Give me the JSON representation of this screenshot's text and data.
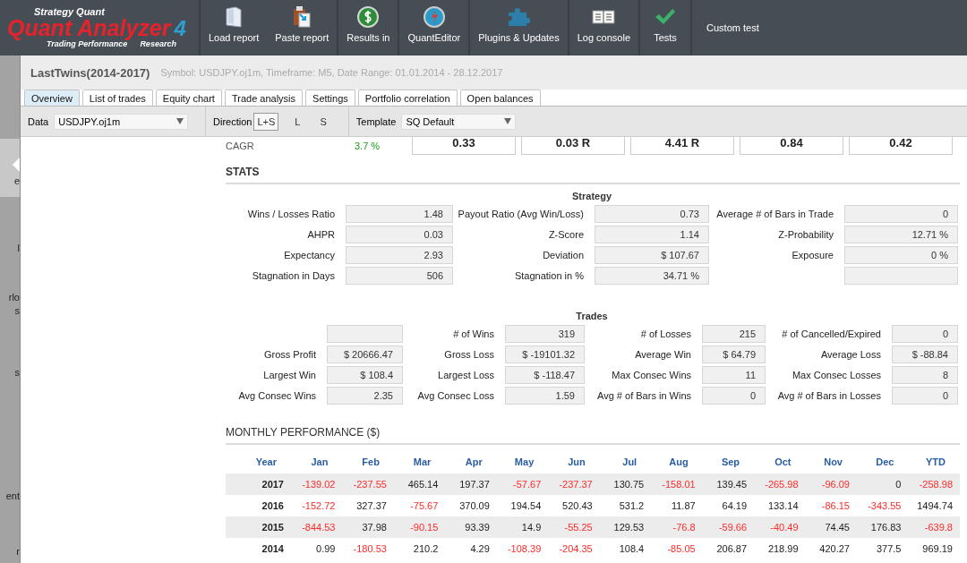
{
  "logo": {
    "brand": "Strategy Quant",
    "product": "Quant Analyzer",
    "version": "4",
    "tagline_left": "Trading Performance",
    "tagline_right": "Research"
  },
  "toolbar": {
    "groups": [
      [
        "Load report",
        "Paste report"
      ],
      [
        "Results in"
      ],
      [
        "QuantEditor"
      ],
      [
        "Plugins & Updates"
      ],
      [
        "Log console"
      ],
      [
        "Tests"
      ],
      [
        "Custom test"
      ]
    ]
  },
  "sidebar": {
    "items": [
      {
        "text": "e",
        "selected": true
      },
      {
        "text": "l",
        "selected": false
      },
      {
        "text": "rlo",
        "selected": false
      },
      {
        "text": "s",
        "selected": false
      },
      {
        "text": "s",
        "selected": false
      },
      {
        "text": "ent",
        "selected": false
      },
      {
        "text": "r",
        "selected": false
      }
    ]
  },
  "report": {
    "title": "LastTwins(2014-2017)",
    "subtitle": "Symbol: USDJPY.oj1m, Timeframe: M5, Date Range: 01.01.2014 - 28.12.2017"
  },
  "tabs": [
    {
      "label": "Overview",
      "selected": true
    },
    {
      "label": "List of trades",
      "selected": false
    },
    {
      "label": "Equity chart",
      "selected": false
    },
    {
      "label": "Trade analysis",
      "selected": false
    },
    {
      "label": "Settings",
      "selected": false
    },
    {
      "label": "Portfolio correlation",
      "selected": false
    },
    {
      "label": "Open balances",
      "selected": false
    }
  ],
  "options": {
    "data_label": "Data",
    "data_value": "USDJPY.oj1m",
    "direction_label": "Direction",
    "directions": [
      {
        "label": "L+S",
        "selected": true
      },
      {
        "label": "L",
        "selected": false
      },
      {
        "label": "S",
        "selected": false
      }
    ],
    "template_label": "Template",
    "template_value": "SQ Default"
  },
  "cagr": {
    "label": "CAGR",
    "value": "3.7 %"
  },
  "headline_values": [
    "0.33",
    "0.03 R",
    "4.41 R",
    "0.84",
    "0.42"
  ],
  "stats_heading": "STATS",
  "strategy": {
    "title": "Strategy",
    "items": [
      {
        "kind": "stat",
        "label": "Wins / Losses Ratio",
        "value": "1.48"
      },
      {
        "kind": "stat",
        "label": "Payout Ratio (Avg Win/Loss)",
        "value": "0.73"
      },
      {
        "kind": "stat",
        "label": "Average # of Bars in Trade",
        "value": "0"
      },
      {
        "kind": "stat",
        "label": "AHPR",
        "value": "0.03"
      },
      {
        "kind": "stat",
        "label": "Z-Score",
        "value": "1.14"
      },
      {
        "kind": "stat",
        "label": "Z-Probability",
        "value": "12.71 %"
      },
      {
        "kind": "stat",
        "label": "Expectancy",
        "value": "2.93"
      },
      {
        "kind": "stat",
        "label": "Deviation",
        "value": "$ 107.67"
      },
      {
        "kind": "stat",
        "label": "Exposure",
        "value": "0 %"
      },
      {
        "kind": "stat",
        "label": "Stagnation in Days",
        "value": "506"
      },
      {
        "kind": "stat",
        "label": "Stagnation in %",
        "value": "34.71 %"
      },
      {
        "kind": "blank"
      }
    ]
  },
  "trades": {
    "title": "Trades",
    "items": [
      {
        "kind": "blank"
      },
      {
        "kind": "stat",
        "label": "# of Wins",
        "value": "319"
      },
      {
        "kind": "stat",
        "label": "# of Losses",
        "value": "215"
      },
      {
        "kind": "stat",
        "label": "# of Cancelled/Expired",
        "value": "0"
      },
      {
        "kind": "stat",
        "label": "Gross Profit",
        "value": "$ 20666.47"
      },
      {
        "kind": "stat",
        "label": "Gross Loss",
        "value": "$ -19101.32"
      },
      {
        "kind": "stat",
        "label": "Average Win",
        "value": "$ 64.79"
      },
      {
        "kind": "stat",
        "label": "Average Loss",
        "value": "$ -88.84"
      },
      {
        "kind": "stat",
        "label": "Largest Win",
        "value": "$ 108.4"
      },
      {
        "kind": "stat",
        "label": "Largest Loss",
        "value": "$ -118.47"
      },
      {
        "kind": "stat",
        "label": "Max Consec Wins",
        "value": "11"
      },
      {
        "kind": "stat",
        "label": "Max Consec Losses",
        "value": "8"
      },
      {
        "kind": "stat",
        "label": "Avg Consec Wins",
        "value": "2.35"
      },
      {
        "kind": "stat",
        "label": "Avg Consec Loss",
        "value": "1.59"
      },
      {
        "kind": "stat",
        "label": "Avg # of Bars in Wins",
        "value": "0"
      },
      {
        "kind": "stat",
        "label": "Avg # of Bars in Losses",
        "value": "0"
      }
    ]
  },
  "monthly": {
    "heading": "MONTHLY PERFORMANCE ($)",
    "columns": [
      "Year",
      "Jan",
      "Feb",
      "Mar",
      "Apr",
      "May",
      "Jun",
      "Jul",
      "Aug",
      "Sep",
      "Oct",
      "Nov",
      "Dec",
      "YTD"
    ],
    "rows": [
      {
        "cells": [
          {
            "text": "2017",
            "negative": false
          },
          {
            "text": "-139.02",
            "negative": true
          },
          {
            "text": "-237.55",
            "negative": true
          },
          {
            "text": "465.14",
            "negative": false
          },
          {
            "text": "197.37",
            "negative": false
          },
          {
            "text": "-57.67",
            "negative": true
          },
          {
            "text": "-237.37",
            "negative": true
          },
          {
            "text": "130.75",
            "negative": false
          },
          {
            "text": "-158.01",
            "negative": true
          },
          {
            "text": "139.45",
            "negative": false
          },
          {
            "text": "-265.98",
            "negative": true
          },
          {
            "text": "-96.09",
            "negative": true
          },
          {
            "text": "0",
            "negative": false
          },
          {
            "text": "-258.98",
            "negative": true
          }
        ]
      },
      {
        "cells": [
          {
            "text": "2016",
            "negative": false
          },
          {
            "text": "-152.72",
            "negative": true
          },
          {
            "text": "327.37",
            "negative": false
          },
          {
            "text": "-75.67",
            "negative": true
          },
          {
            "text": "370.09",
            "negative": false
          },
          {
            "text": "194.54",
            "negative": false
          },
          {
            "text": "520.43",
            "negative": false
          },
          {
            "text": "531.2",
            "negative": false
          },
          {
            "text": "11.87",
            "negative": false
          },
          {
            "text": "64.19",
            "negative": false
          },
          {
            "text": "133.14",
            "negative": false
          },
          {
            "text": "-86.15",
            "negative": true
          },
          {
            "text": "-343.55",
            "negative": true
          },
          {
            "text": "1494.74",
            "negative": false
          }
        ]
      },
      {
        "cells": [
          {
            "text": "2015",
            "negative": false
          },
          {
            "text": "-844.53",
            "negative": true
          },
          {
            "text": "37.98",
            "negative": false
          },
          {
            "text": "-90.15",
            "negative": true
          },
          {
            "text": "93.39",
            "negative": false
          },
          {
            "text": "14.9",
            "negative": false
          },
          {
            "text": "-55.25",
            "negative": true
          },
          {
            "text": "129.53",
            "negative": false
          },
          {
            "text": "-76.8",
            "negative": true
          },
          {
            "text": "-59.66",
            "negative": true
          },
          {
            "text": "-40.49",
            "negative": true
          },
          {
            "text": "74.45",
            "negative": false
          },
          {
            "text": "176.83",
            "negative": false
          },
          {
            "text": "-639.8",
            "negative": true
          }
        ]
      },
      {
        "cells": [
          {
            "text": "2014",
            "negative": false
          },
          {
            "text": "0.99",
            "negative": false
          },
          {
            "text": "-180.53",
            "negative": true
          },
          {
            "text": "210.2",
            "negative": false
          },
          {
            "text": "4.29",
            "negative": false
          },
          {
            "text": "-108.39",
            "negative": true
          },
          {
            "text": "-204.35",
            "negative": true
          },
          {
            "text": "108.4",
            "negative": false
          },
          {
            "text": "-85.05",
            "negative": true
          },
          {
            "text": "206.87",
            "negative": false
          },
          {
            "text": "218.99",
            "negative": false
          },
          {
            "text": "420.27",
            "negative": false
          },
          {
            "text": "377.5",
            "negative": false
          },
          {
            "text": "969.19",
            "negative": false
          }
        ]
      }
    ]
  }
}
